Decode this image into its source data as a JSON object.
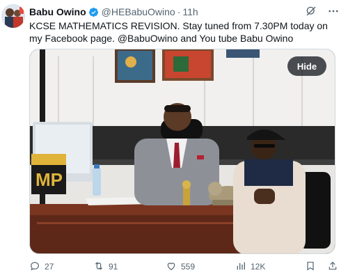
{
  "author": {
    "name": "Babu Owino",
    "handle": "@HEBabuOwino",
    "time": "11h",
    "separator": "·"
  },
  "tweet": {
    "text": "KCSE MATHEMATICS REVISION. Stay tuned from 7.30PM today on my Facebook page. @BabuOwino and You tube Babu Owino"
  },
  "media": {
    "hide_label": "Hide",
    "plaque_text": "MP"
  },
  "metrics": {
    "replies": "27",
    "retweets": "91",
    "likes": "559",
    "views": "12K"
  },
  "colors": {
    "verified": "#1d9bf0",
    "muted": "#536471",
    "text": "#0f1419"
  },
  "icons": {
    "verified": "verified-badge-icon",
    "grok": "grok-icon",
    "more": "more-icon",
    "reply": "reply-icon",
    "retweet": "retweet-icon",
    "like": "heart-icon",
    "views": "views-icon",
    "bookmark": "bookmark-icon",
    "share": "share-icon"
  }
}
